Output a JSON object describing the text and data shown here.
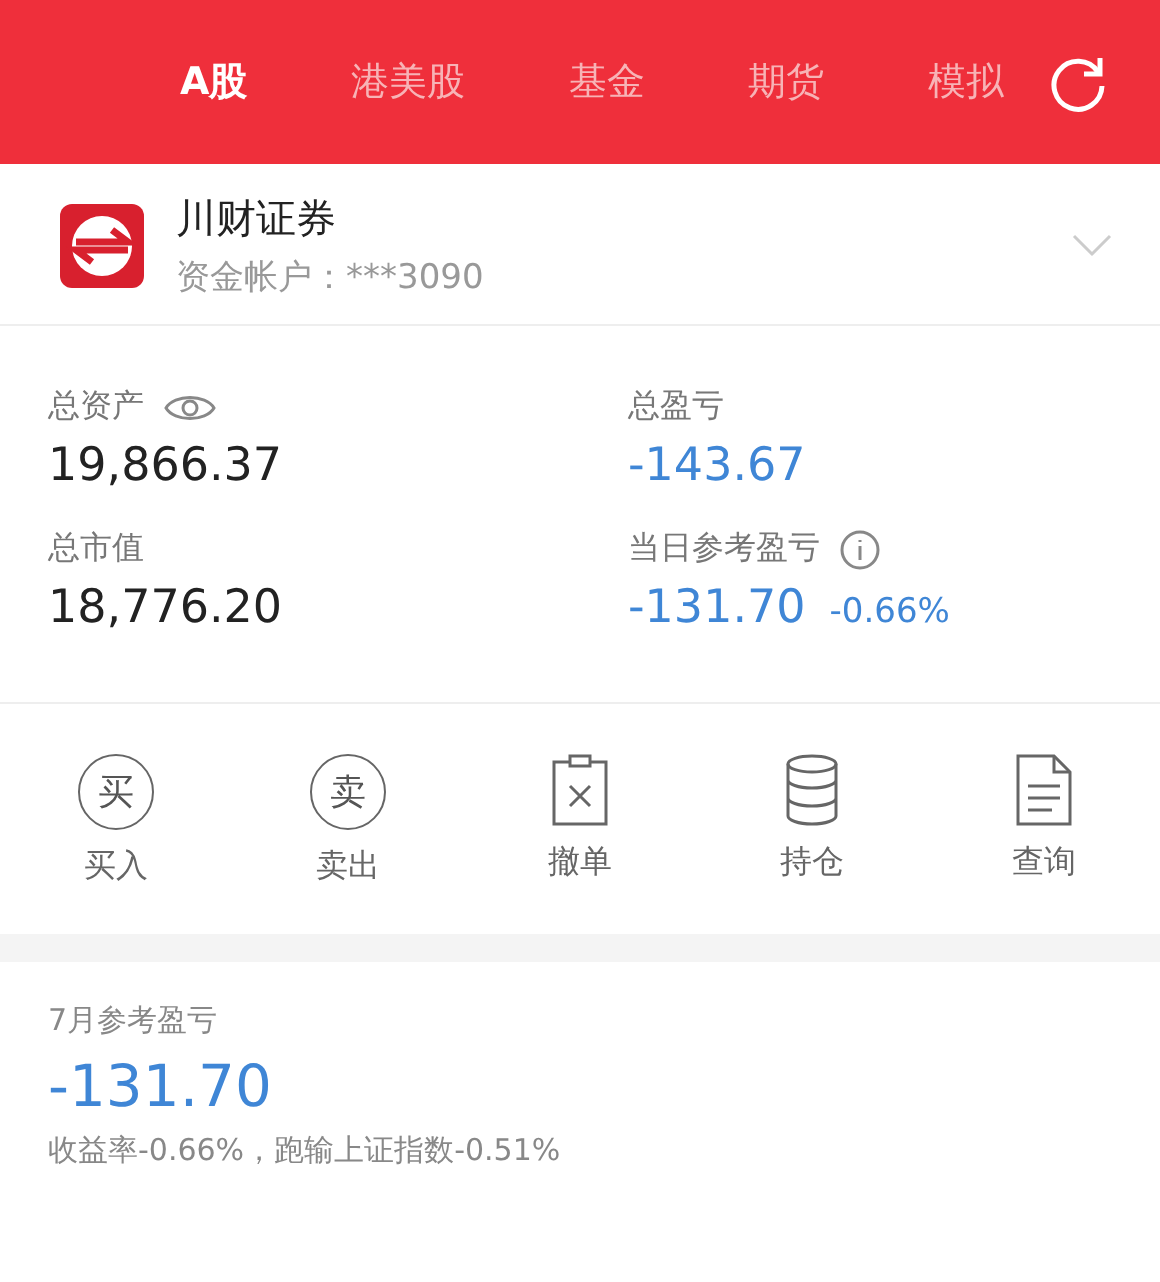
{
  "tabs": [
    {
      "label": "A股",
      "selected": true
    },
    {
      "label": "港美股",
      "selected": false
    },
    {
      "label": "基金",
      "selected": false
    },
    {
      "label": "期货",
      "selected": false
    },
    {
      "label": "模拟",
      "selected": false
    }
  ],
  "account": {
    "broker": "川财证券",
    "account_line": "资金帐户：***3090"
  },
  "stats": [
    {
      "label": "总资产",
      "kind": "eye",
      "value": "19,866.37",
      "color": "#222222"
    },
    {
      "label": "总盈亏",
      "kind": "plain",
      "value": "-143.67",
      "color": "#3f86d6"
    },
    {
      "label": "总市值",
      "kind": "plain",
      "value": "18,776.20",
      "color": "#222222"
    },
    {
      "label": "当日参考盈亏",
      "kind": "info",
      "value": "-131.70",
      "extra": "-0.66%",
      "color": "#3f86d6"
    }
  ],
  "actions": [
    {
      "label": "买入",
      "kind": "glyph",
      "glyph": "买"
    },
    {
      "label": "卖出",
      "kind": "glyph",
      "glyph": "卖"
    },
    {
      "label": "撤单",
      "kind": "cancel"
    },
    {
      "label": "持仓",
      "kind": "stack"
    },
    {
      "label": "查询",
      "kind": "doc"
    }
  ],
  "monthly": {
    "title": "7月参考盈亏",
    "value": "-131.70",
    "color": "#3f86d6",
    "note": "收益率-0.66%，跑输上证指数-0.51%"
  }
}
